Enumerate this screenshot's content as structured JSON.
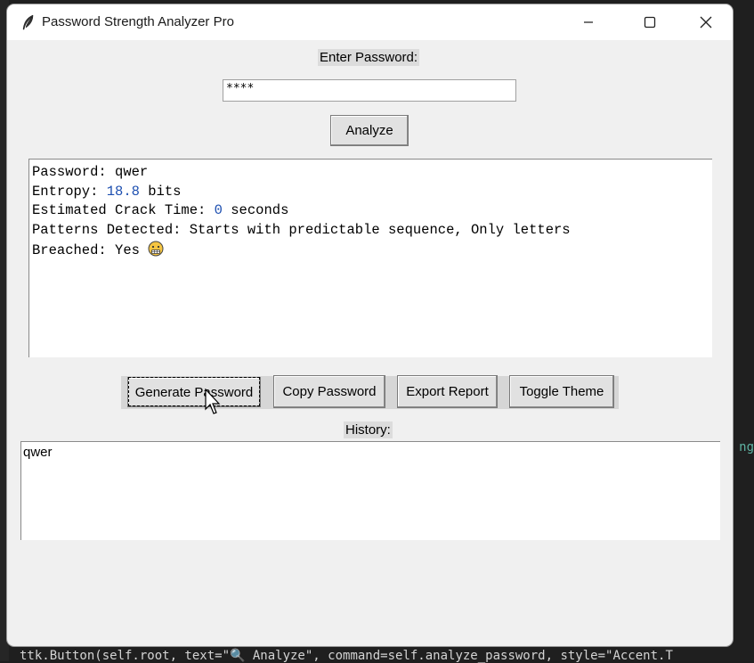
{
  "window": {
    "title": "Password Strength Analyzer Pro"
  },
  "form": {
    "enter_label": "Enter Password:",
    "password_masked": "****",
    "analyze_label": "Analyze"
  },
  "results": {
    "lines": [
      {
        "prefix": "Password: ",
        "value": "qwer",
        "suffix": ""
      },
      {
        "prefix": "Entropy: ",
        "value": "18.8",
        "suffix": " bits"
      },
      {
        "prefix": "Estimated Crack Time: ",
        "value": "0",
        "suffix": " seconds"
      },
      {
        "prefix": "Patterns Detected: ",
        "value": "Starts with predictable sequence, Only letters",
        "suffix": ""
      },
      {
        "prefix": "Breached: ",
        "value": "Yes",
        "suffix": ""
      }
    ]
  },
  "actions": {
    "generate_label": "Generate Password",
    "copy_label": "Copy Password",
    "export_label": "Export Report",
    "theme_label": "Toggle Theme"
  },
  "history": {
    "label": "History:",
    "items": [
      "qwer"
    ]
  },
  "background": {
    "right_text": "ng",
    "bottom_code": "ttk.Button(self.root, text=\"🔍 Analyze\", command=self.analyze_password, style=\"Accent.T"
  },
  "icons": {
    "app": "feather-icon",
    "breached": "grimace-face-icon"
  },
  "colors": {
    "window_bg": "#f0f0f0",
    "number_blue": "#1d4fb0"
  }
}
